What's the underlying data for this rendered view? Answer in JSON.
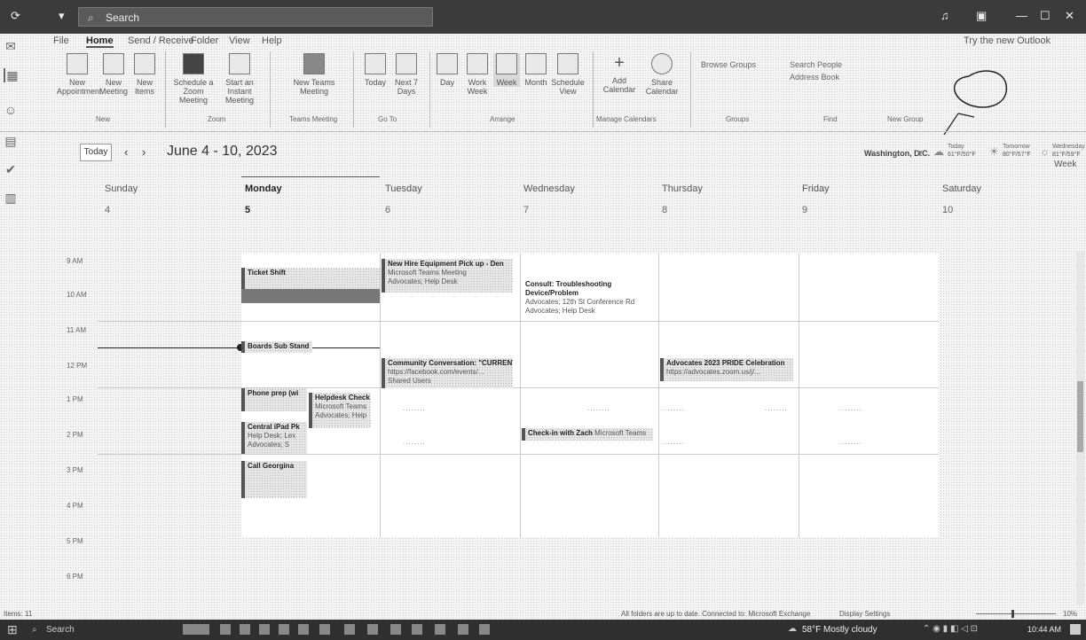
{
  "titlebar": {
    "search_placeholder": "Search",
    "try_new": "Try the new Outlook"
  },
  "menu": {
    "tabs": [
      "File",
      "Home",
      "Send / Receive",
      "Folder",
      "View",
      "Help"
    ]
  },
  "ribbon": {
    "buttons": [
      {
        "label": "New Appointment"
      },
      {
        "label": "New Meeting"
      },
      {
        "label": "New Items"
      },
      {
        "label": "Schedule a Zoom Meeting"
      },
      {
        "label": "Start an Instant Meeting"
      },
      {
        "label": "New Teams Meeting"
      },
      {
        "label": "Today"
      },
      {
        "label": "Next 7 Days"
      },
      {
        "label": "Day"
      },
      {
        "label": "Work Week"
      },
      {
        "label": "Week"
      },
      {
        "label": "Month"
      },
      {
        "label": "Schedule View"
      },
      {
        "label": "Add Calendar"
      },
      {
        "label": "Share Calendar"
      }
    ],
    "browse_groups": "Browse Groups",
    "search_people": "Search People",
    "address_book": "Address Book",
    "groups": [
      "New",
      "Zoom",
      "Teams Meeting",
      "Go To",
      "Arrange",
      "Manage Calendars",
      "Groups",
      "Find",
      "New Group"
    ]
  },
  "calendar": {
    "today_button": "Today",
    "date_range": "June 4 - 10, 2023",
    "location": "Washington, D.C.",
    "weather": [
      {
        "day": "Today",
        "temp": "61°F/50°F"
      },
      {
        "day": "Tomorrow",
        "temp": "80°F/57°F"
      },
      {
        "day": "Wednesday",
        "temp": "81°F/59°F"
      }
    ],
    "view_button": "Week",
    "days": [
      {
        "name": "Sunday",
        "num": "4"
      },
      {
        "name": "Monday",
        "num": "5"
      },
      {
        "name": "Tuesday",
        "num": "6"
      },
      {
        "name": "Wednesday",
        "num": "7"
      },
      {
        "name": "Thursday",
        "num": "8"
      },
      {
        "name": "Friday",
        "num": "9"
      },
      {
        "name": "Saturday",
        "num": "10"
      }
    ],
    "times": [
      "9 AM",
      "10 AM",
      "11 AM",
      "12 PM",
      "1 PM",
      "2 PM",
      "3 PM",
      "4 PM",
      "5 PM",
      "6 PM"
    ],
    "events": {
      "ticket_shift": {
        "title": "Ticket Shift"
      },
      "new_hire": {
        "title": "New Hire Equipment Pick up - Den",
        "line2": "Microsoft Teams Meeting",
        "line3": "Advocates; Help Desk"
      },
      "consult": {
        "title": "Consult: Troubleshooting",
        "title2": "Device/Problem",
        "line2": "Advocates; 12th St Conference Rd",
        "line3": "Advocates; Help Desk"
      },
      "boards": {
        "title": "Boards Sub Stand"
      },
      "community": {
        "title": "Community Conversation: \"CURRENT",
        "line2": "https://facebook.com/events/...",
        "line3": "Shared Users"
      },
      "advocates_pride": {
        "title": "Advocates 2023 PRIDE Celebration",
        "line2": "https://advocates.zoom.us/j/..."
      },
      "phone_prep": {
        "title": "Phone prep (wi"
      },
      "helpdesk_check": {
        "title": "Helpdesk Check",
        "line2": "Microsoft Teams",
        "line3": "Advocates; Help"
      },
      "central_pad": {
        "title": "Central iPad Pk",
        "line2": "Help Desk; Lex",
        "line3": "Advocates; S"
      },
      "checkin_zach": {
        "title": "Check-in with Zach",
        "line2": "Microsoft Teams"
      },
      "call_georgina": {
        "title": "Call Georgina"
      }
    }
  },
  "statusbar": {
    "items": "Items: 11",
    "connection": "All folders are up to date.  Connected to: Microsoft Exchange",
    "display": "Display Settings",
    "zoom": "10%"
  },
  "taskbar": {
    "search": "Search",
    "weather": "58°F  Mostly cloudy",
    "time": "10:44 AM"
  }
}
